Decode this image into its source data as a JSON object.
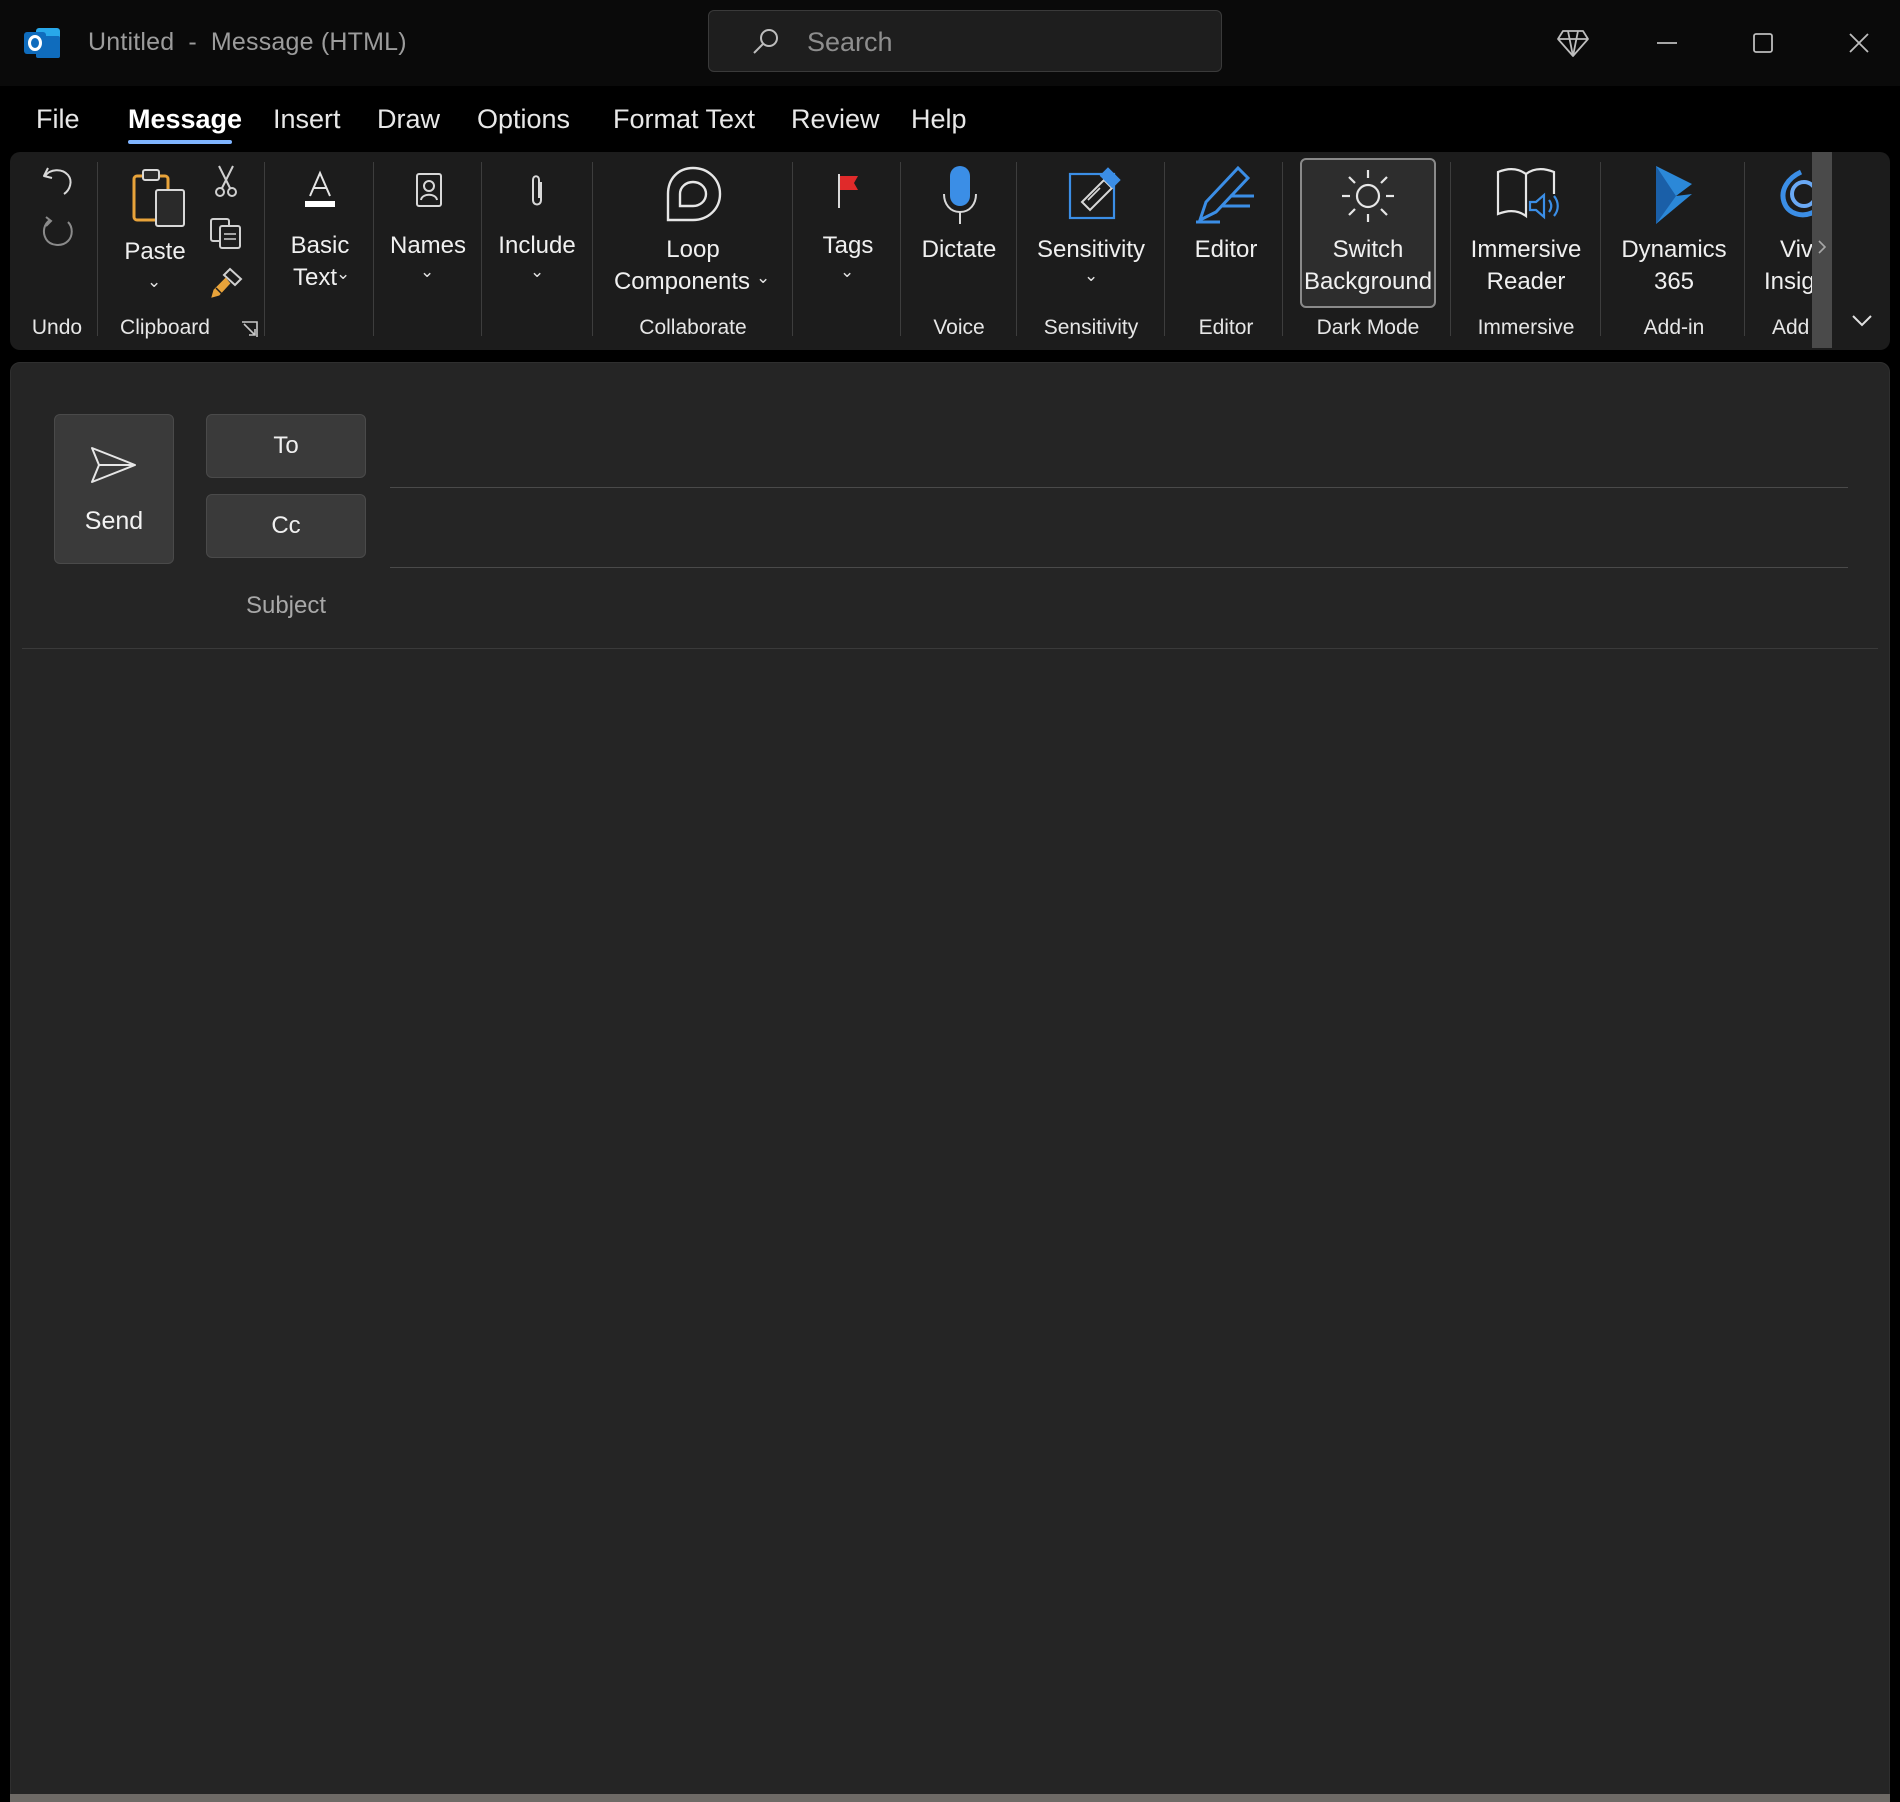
{
  "window": {
    "title_doc": "Untitled",
    "title_sep": "-",
    "title_type": "Message (HTML)",
    "search_placeholder": "Search"
  },
  "tabs": [
    "File",
    "Message",
    "Insert",
    "Draw",
    "Options",
    "Format Text",
    "Review",
    "Help"
  ],
  "ribbon": {
    "groups": {
      "undo": "Undo",
      "clipboard": "Clipboard",
      "collaborate": "Collaborate",
      "voice": "Voice",
      "sensitivity": "Sensitivity",
      "editor": "Editor",
      "dark_mode": "Dark Mode",
      "immersive": "Immersive",
      "addin": "Add-in",
      "addin2": "Add"
    },
    "buttons": {
      "paste": "Paste",
      "basic_text_1": "Basic",
      "basic_text_2": "Text",
      "names": "Names",
      "include": "Include",
      "loop_1": "Loop",
      "loop_2": "Components",
      "tags": "Tags",
      "dictate": "Dictate",
      "sensitivity": "Sensitivity",
      "editor": "Editor",
      "switch_1": "Switch",
      "switch_2": "Background",
      "immersive_1": "Immersive",
      "immersive_2": "Reader",
      "dynamics_1": "Dynamics",
      "dynamics_2": "365",
      "viva_1": "Viva",
      "viva_2": "Insights"
    }
  },
  "compose": {
    "send": "Send",
    "to": "To",
    "cc": "Cc",
    "subject": "Subject",
    "to_value": "",
    "cc_value": "",
    "subject_value": ""
  },
  "colors": {
    "outlook_blue": "#0f6cbd",
    "accent_underline": "#7fb4ff",
    "paste_orange": "#e8a33a",
    "flag_red": "#e02a2a"
  }
}
